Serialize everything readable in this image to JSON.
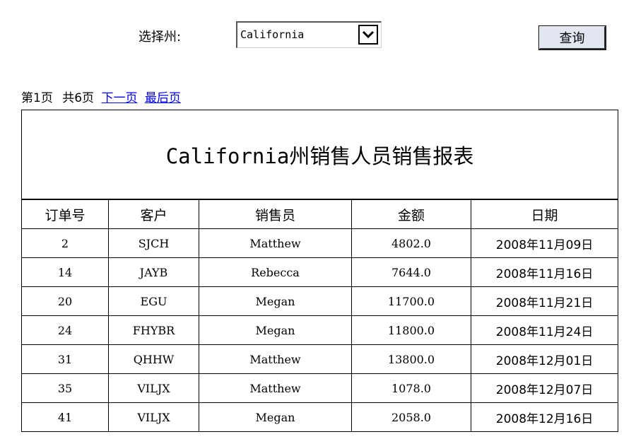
{
  "filter": {
    "state_label": "选择州:",
    "selected_state": "California",
    "query_button": "查询"
  },
  "pager": {
    "current": "第1页",
    "total": "共6页",
    "next": "下一页",
    "last": "最后页"
  },
  "report": {
    "title": "California州销售人员销售报表",
    "columns": [
      "订单号",
      "客户",
      "销售员",
      "金额",
      "日期"
    ],
    "rows": [
      [
        "2",
        "SJCH",
        "Matthew",
        "4802.0",
        "2008年11月09日"
      ],
      [
        "14",
        "JAYB",
        "Rebecca",
        "7644.0",
        "2008年11月16日"
      ],
      [
        "20",
        "EGU",
        "Megan",
        "11700.0",
        "2008年11月21日"
      ],
      [
        "24",
        "FHYBR",
        "Megan",
        "11800.0",
        "2008年11月24日"
      ],
      [
        "31",
        "QHHW",
        "Matthew",
        "13800.0",
        "2008年12月01日"
      ],
      [
        "35",
        "VILJX",
        "Matthew",
        "1078.0",
        "2008年12月07日"
      ],
      [
        "41",
        "VILJX",
        "Megan",
        "2058.0",
        "2008年12月16日"
      ]
    ]
  },
  "icons": {
    "select_arrow": "chevron-down-icon"
  }
}
